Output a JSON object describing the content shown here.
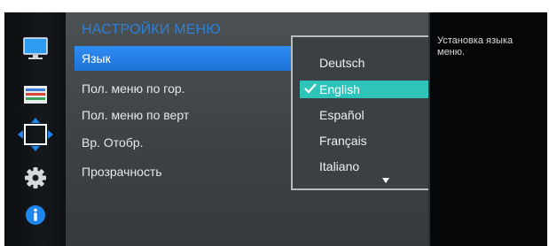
{
  "sidebar": {
    "items": [
      {
        "name": "picture-icon"
      },
      {
        "name": "onscreen-display-icon"
      },
      {
        "name": "position-icon"
      },
      {
        "name": "setup-gear-icon"
      },
      {
        "name": "information-icon"
      }
    ]
  },
  "menu": {
    "title": "НАСТРОЙКИ МЕНЮ",
    "items": [
      {
        "label": "Язык",
        "active": true
      },
      {
        "label": "Пол. меню по гор.",
        "active": false
      },
      {
        "label": "Пол. меню по верт",
        "active": false
      },
      {
        "label": "Вр. Отобр.",
        "active": false
      },
      {
        "label": "Прозрачность",
        "active": false
      }
    ]
  },
  "language_dropdown": {
    "options": [
      "Deutsch",
      "English",
      "Español",
      "Français",
      "Italiano"
    ],
    "selected": "English",
    "more_indicator_icon": "triangle-down-icon"
  },
  "help": {
    "text": "Установка языка меню."
  },
  "colors": {
    "accent_blue": "#1e73d8",
    "title_blue": "#2f7fd6",
    "selection_teal": "#2fc4b9"
  }
}
